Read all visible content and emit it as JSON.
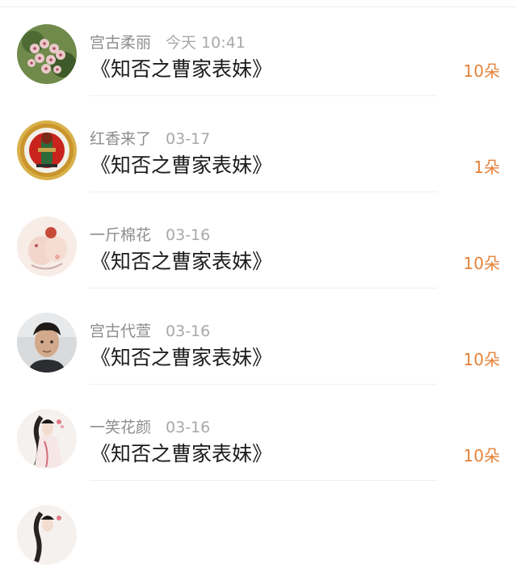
{
  "items": [
    {
      "name": "宫古柔丽",
      "time": "今天 10:41",
      "work": "《知否之曹家表妹》",
      "flowers": "10朵",
      "avatar": "hoya-flower-avatar"
    },
    {
      "name": "红香来了",
      "time": "03-17",
      "work": "《知否之曹家表妹》",
      "flowers": "1朵",
      "avatar": "guan-gong-coin-avatar"
    },
    {
      "name": "一斤棉花",
      "time": "03-16",
      "work": "《知否之曹家表妹》",
      "flowers": "10朵",
      "avatar": "cute-cartoon-avatar"
    },
    {
      "name": "宫古代萱",
      "time": "03-16",
      "work": "《知否之曹家表妹》",
      "flowers": "10朵",
      "avatar": "young-man-photo-avatar"
    },
    {
      "name": "一笑花颜",
      "time": "03-16",
      "work": "《知否之曹家表妹》",
      "flowers": "10朵",
      "avatar": "ancient-beauty-avatar"
    },
    {
      "name": "",
      "time": "",
      "work": "",
      "flowers": "",
      "avatar": "ancient-beauty-avatar"
    }
  ],
  "colors": {
    "flower_count": "#e5823a",
    "meta_text": "#8d8d8d",
    "title_text": "#1c1c1c"
  }
}
